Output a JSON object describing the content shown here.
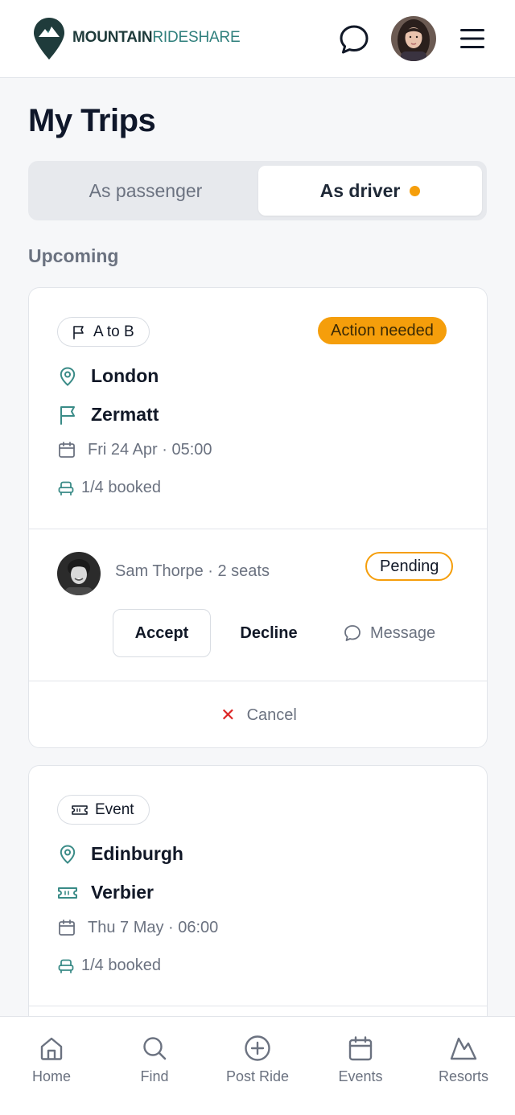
{
  "header": {
    "brand_bold": "MOUNTAIN",
    "brand_light": "RIDESHARE"
  },
  "page": {
    "title": "My Trips"
  },
  "tabs": {
    "passenger": "As passenger",
    "driver": "As driver"
  },
  "section": {
    "upcoming": "Upcoming"
  },
  "trips": [
    {
      "type_label": "A to B",
      "status_badge": "Action needed",
      "from": "London",
      "to": "Zermatt",
      "datetime": "Fri 24 Apr · 05:00",
      "booked": "1/4 booked",
      "request": {
        "name_seats": "Sam Thorpe · 2 seats",
        "status": "Pending",
        "accept_label": "Accept",
        "decline_label": "Decline",
        "message_label": "Message"
      },
      "cancel_label": "Cancel"
    },
    {
      "type_label": "Event",
      "from": "Edinburgh",
      "to": "Verbier",
      "datetime": "Thu 7 May · 06:00",
      "booked": "1/4 booked"
    }
  ],
  "nav": {
    "home": "Home",
    "find": "Find",
    "post_ride": "Post Ride",
    "events": "Events",
    "resorts": "Resorts"
  },
  "colors": {
    "accent_amber": "#f59e0b",
    "brand_teal": "#2f7f7c",
    "danger": "#dc2626"
  }
}
